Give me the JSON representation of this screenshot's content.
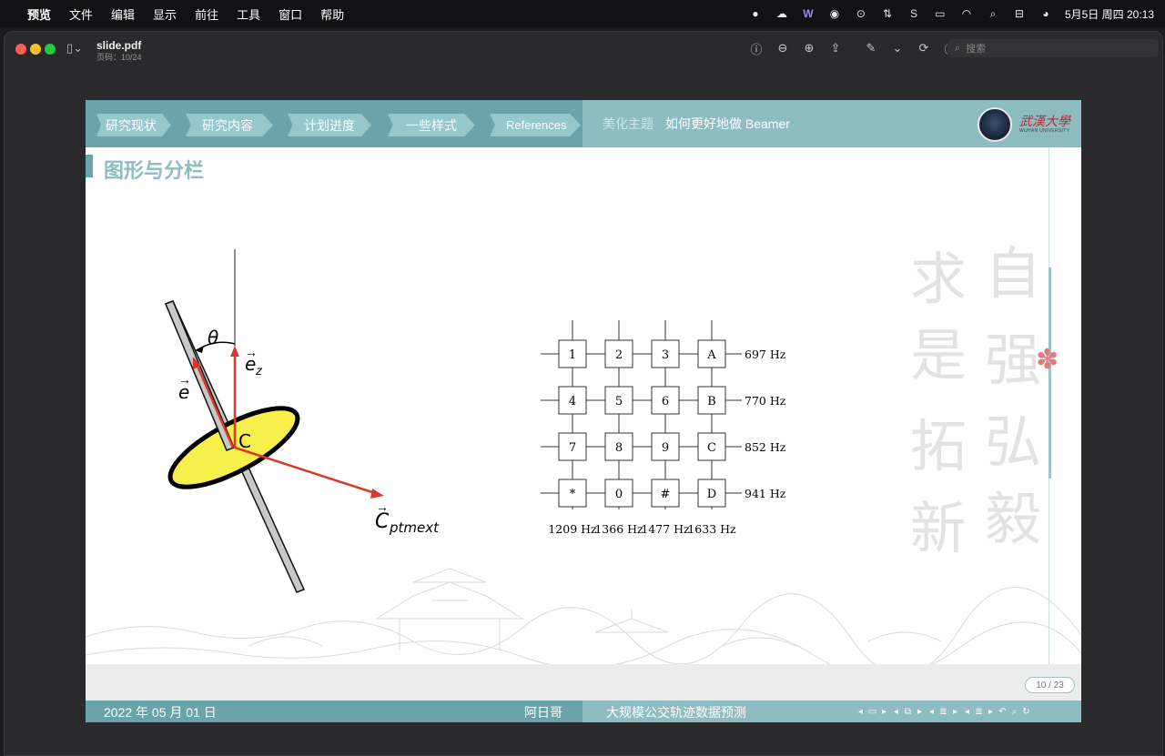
{
  "menubar": {
    "app": "预览",
    "items": [
      "文件",
      "编辑",
      "显示",
      "前往",
      "工具",
      "窗口",
      "帮助"
    ],
    "clock": "5月5日 周四  20:13"
  },
  "window": {
    "filename": "slide.pdf",
    "page_info": "页码：10/24",
    "search_placeholder": "搜索"
  },
  "slide": {
    "nav_tabs": [
      "研究现状",
      "研究内容",
      "计划进度",
      "一些样式",
      "References"
    ],
    "section": "美化主题",
    "subtitle": "如何更好地做 Beamer",
    "logo_text": "武漢大學",
    "logo_sub": "WUHAN UNIVERSITY",
    "frame_title": "图形与分栏",
    "calligraphy_left": [
      "求",
      "是",
      "拓",
      "新"
    ],
    "calligraphy_right": [
      "自",
      "强",
      "弘",
      "毅"
    ],
    "page_indicator": "10 / 23",
    "footer": {
      "date": "2022 年 05 月 01 日",
      "author": "阿日哥",
      "title": "大规模公交轨迹数据预测"
    },
    "figure": {
      "theta": "θ",
      "ez": "e",
      "ez_sub": "z",
      "e": "e",
      "c": "C",
      "cptm": "C",
      "cptm_sub": "ptmext"
    },
    "keypad": {
      "keys": [
        [
          "1",
          "2",
          "3",
          "A"
        ],
        [
          "4",
          "5",
          "6",
          "B"
        ],
        [
          "7",
          "8",
          "9",
          "C"
        ],
        [
          "*",
          "0",
          "#",
          "D"
        ]
      ],
      "row_freqs": [
        "697 Hz",
        "770 Hz",
        "852 Hz",
        "941 Hz"
      ],
      "col_freqs": [
        "1209 Hz",
        "1366 Hz",
        "1477 Hz",
        "1633 Hz"
      ]
    }
  },
  "colors": {
    "header_dark": "#6aa3a9",
    "header_light": "#8dbcc1",
    "disc_fill": "#f7ef4a",
    "vector_red": "#d83a2a"
  }
}
